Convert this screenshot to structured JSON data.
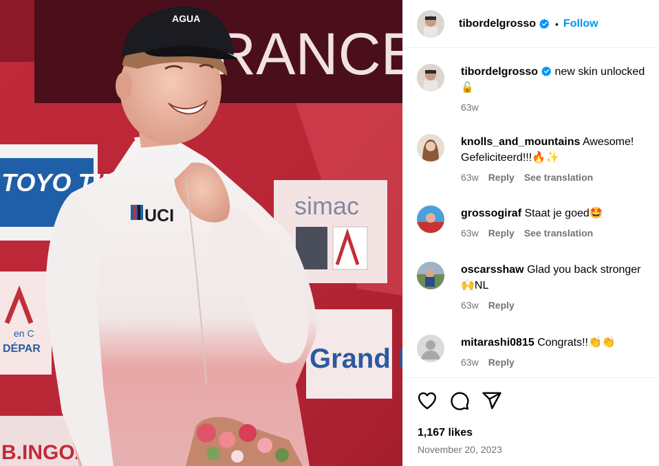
{
  "post": {
    "username": "tibordelgrosso",
    "separator": "•",
    "follow_label": "Follow",
    "photo": {
      "jersey_text": "UCI",
      "cap_text": "AGUA",
      "banner_text": "RANCE",
      "sign_left": "TOYO TIR",
      "sign_simac": "simac",
      "sign_grand_est": "Grand Est",
      "sign_depart": "DÉPAR",
      "sign_en": "en C",
      "sign_bingo": "B.INGOA"
    }
  },
  "caption": {
    "username": "tibordelgrosso",
    "text": "new skin unlocked",
    "emoji": "🔓",
    "time": "63w"
  },
  "comments": [
    {
      "username": "knolls_and_mountains",
      "text": "Awesome! Gefeliciteerd!!!🔥✨",
      "time": "63w",
      "reply_label": "Reply",
      "translate_label": "See translation"
    },
    {
      "username": "grossogiraf",
      "text": "Staat je goed🤩",
      "time": "63w",
      "reply_label": "Reply",
      "translate_label": "See translation"
    },
    {
      "username": "oscarsshaw",
      "text": "Glad you back stronger 🙌NL",
      "time": "63w",
      "reply_label": "Reply",
      "translate_label": ""
    },
    {
      "username": "mitarashi0815",
      "text": "Congrats!!👏👏",
      "time": "63w",
      "reply_label": "Reply",
      "translate_label": ""
    }
  ],
  "stats": {
    "likes": "1,167 likes",
    "date": "November 20, 2023"
  },
  "icons": {
    "like": "heart-icon",
    "comment": "comment-icon",
    "share": "share-icon",
    "verified": "verified-badge-icon"
  },
  "colors": {
    "accent": "#0095f6",
    "muted": "#737373",
    "border": "#efefef",
    "photo_red": "#b42535"
  }
}
